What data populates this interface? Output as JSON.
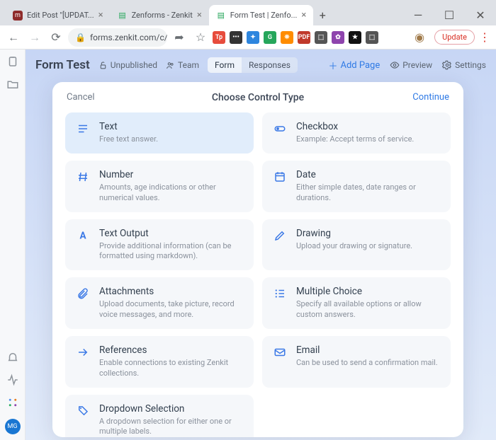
{
  "browser": {
    "tabs": [
      {
        "title": "Edit Post \"[UPDAT...",
        "favbg": "#8e2b2b",
        "favtxt": "m"
      },
      {
        "title": "Zenforms - Zenkit",
        "favbg": "#ffffff",
        "favglyph": "▤"
      },
      {
        "title": "Form Test | Zenfo...",
        "favbg": "#ffffff",
        "favglyph": "▤"
      }
    ],
    "newtab": "+",
    "wincontrols": {
      "min": "—",
      "max": "☐",
      "close": "✕"
    },
    "nav": {
      "back": "←",
      "forward": "→",
      "reload": "⟳"
    },
    "lock": "🔒",
    "url": "forms.zenkit.com/c/PcO…",
    "share": "➦",
    "star": "☆",
    "ext_labels": [
      "Tp",
      "•••",
      "✦",
      "G",
      "⛯",
      "PDF",
      "⬚",
      "✿",
      "★",
      "⬚"
    ],
    "ext_colors": [
      "#e74c3c",
      "#333",
      "#2e86de",
      "#26a65b",
      "#ff8c00",
      "#c0392b",
      "#555",
      "#8e44ad",
      "#111",
      "#555"
    ],
    "avatar_ext": "◉",
    "update": "Update",
    "menu": "⋮"
  },
  "app": {
    "sidebar_icons": [
      "clipboard",
      "folder",
      "bell",
      "activity",
      "apps"
    ],
    "avatar": "MG",
    "title": "Form Test",
    "unpublished": "Unpublished",
    "team": "Team",
    "seg_form": "Form",
    "seg_responses": "Responses",
    "add_page": "Add Page",
    "preview": "Preview",
    "settings": "Settings"
  },
  "modal": {
    "cancel": "Cancel",
    "title": "Choose Control Type",
    "continue": "Continue",
    "controls": [
      {
        "id": "text",
        "title": "Text",
        "desc": "Free text answer.",
        "icon": "lines",
        "selected": true
      },
      {
        "id": "checkbox",
        "title": "Checkbox",
        "desc": "Example: Accept terms of service.",
        "icon": "toggle"
      },
      {
        "id": "number",
        "title": "Number",
        "desc": "Amounts, age indications or other numerical values.",
        "icon": "hash"
      },
      {
        "id": "date",
        "title": "Date",
        "desc": "Either simple dates, date ranges or durations.",
        "icon": "calendar"
      },
      {
        "id": "textoutput",
        "title": "Text Output",
        "desc": "Provide additional information (can be formatted using markdown).",
        "icon": "A"
      },
      {
        "id": "drawing",
        "title": "Drawing",
        "desc": "Upload your drawing or signature.",
        "icon": "pencil"
      },
      {
        "id": "attachments",
        "title": "Attachments",
        "desc": "Upload documents, take picture, record voice messages, and more.",
        "icon": "clip"
      },
      {
        "id": "multiple",
        "title": "Multiple Choice",
        "desc": "Specify all available options or allow custom answers.",
        "icon": "list"
      },
      {
        "id": "references",
        "title": "References",
        "desc": "Enable connections to existing Zenkit collections.",
        "icon": "arrow"
      },
      {
        "id": "email",
        "title": "Email",
        "desc": "Can be used to send a confirmation mail.",
        "icon": "mail"
      },
      {
        "id": "dropdown",
        "title": "Dropdown Selection",
        "desc": "A dropdown selection for either one or multiple labels.",
        "icon": "tag"
      }
    ]
  }
}
